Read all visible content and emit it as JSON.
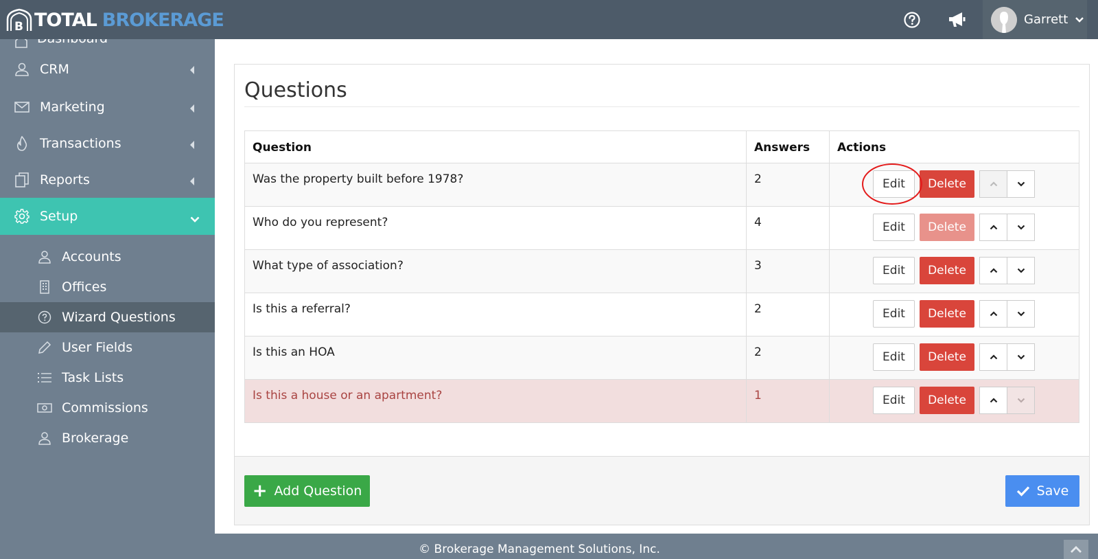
{
  "app": {
    "logo_text_1": "TOTAL",
    "logo_text_2": "BROKERAGE"
  },
  "header": {
    "help_icon": "question-circle-icon",
    "announce_icon": "megaphone-icon",
    "user_name": "Garrett"
  },
  "sidebar": {
    "partial_item": "Dashboard",
    "items": [
      {
        "label": "CRM",
        "icon": "user-icon"
      },
      {
        "label": "Marketing",
        "icon": "envelope-icon"
      },
      {
        "label": "Transactions",
        "icon": "flame-icon"
      },
      {
        "label": "Reports",
        "icon": "copy-icon"
      },
      {
        "label": "Setup",
        "icon": "gear-icon",
        "active": true
      }
    ],
    "sub_items": [
      {
        "label": "Accounts",
        "icon": "user-icon"
      },
      {
        "label": "Offices",
        "icon": "building-icon"
      },
      {
        "label": "Wizard Questions",
        "icon": "question-circle-icon",
        "active": true
      },
      {
        "label": "User Fields",
        "icon": "pencil-icon"
      },
      {
        "label": "Task Lists",
        "icon": "list-icon"
      },
      {
        "label": "Commissions",
        "icon": "money-icon"
      },
      {
        "label": "Brokerage",
        "icon": "user-icon"
      }
    ]
  },
  "panel": {
    "title": "Questions",
    "columns": [
      "Question",
      "Answers",
      "Actions"
    ],
    "rows": [
      {
        "question": "Was the property built before 1978?",
        "answers": "2"
      },
      {
        "question": "Who do you represent?",
        "answers": "4"
      },
      {
        "question": "What type of association?",
        "answers": "3"
      },
      {
        "question": "Is this a referral?",
        "answers": "2"
      },
      {
        "question": "Is this an HOA",
        "answers": "2"
      },
      {
        "question": "Is this a house or an apartment?",
        "answers": "1"
      }
    ],
    "edit_label": "Edit",
    "delete_label": "Delete",
    "add_label": "Add Question",
    "save_label": "Save"
  },
  "footer": {
    "copyright": "© Brokerage Management Solutions, Inc."
  },
  "colors": {
    "topbar": "#4d5b69",
    "sidebar": "#6f7f8f",
    "active_nav": "#3ec4b1",
    "delete": "#d9453b",
    "add": "#3aa847",
    "save": "#4a8ef0"
  }
}
